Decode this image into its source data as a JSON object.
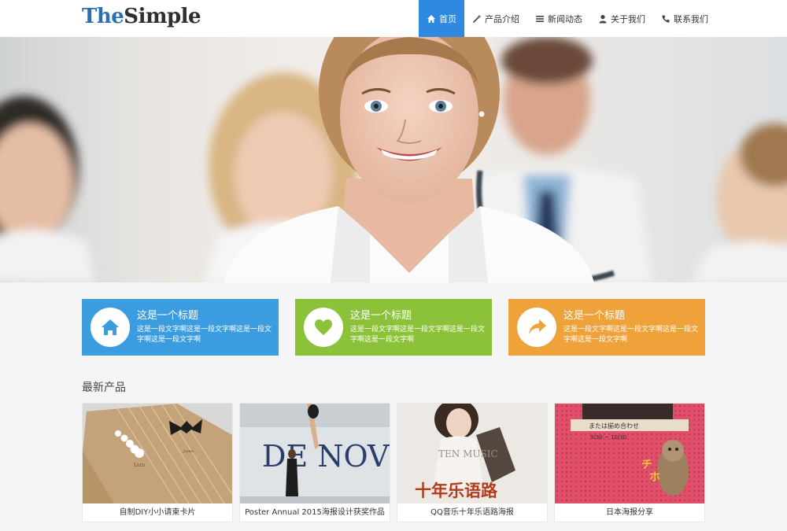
{
  "logo": {
    "part1": "The",
    "part2": "Simple"
  },
  "nav": [
    {
      "label": "首页",
      "icon": "home-icon",
      "active": true
    },
    {
      "label": "产品介绍",
      "icon": "magic-wand-icon",
      "active": false
    },
    {
      "label": "新闻动态",
      "icon": "list-icon",
      "active": false
    },
    {
      "label": "关于我们",
      "icon": "user-icon",
      "active": false
    },
    {
      "label": "联系我们",
      "icon": "phone-icon",
      "active": false
    }
  ],
  "features": [
    {
      "title": "这是一个标题",
      "desc": "这是一段文字啊这是一段文字啊这是一段文字啊这是一段文字啊",
      "icon": "home-icon",
      "color": "#3b9de0"
    },
    {
      "title": "这是一个标题",
      "desc": "这是一段文字啊这是一段文字啊这是一段文字啊这是一段文字啊",
      "icon": "heart-icon",
      "color": "#8cc23a"
    },
    {
      "title": "这是一个标题",
      "desc": "这是一段文字啊这是一段文字啊这是一段文字啊这是一段文字啊",
      "icon": "share-arrow-icon",
      "color": "#f0a23a"
    }
  ],
  "section": {
    "title": "最新产品"
  },
  "products": [
    {
      "caption": "自制DIY小小请柬卡片"
    },
    {
      "caption": "Poster Annual 2015海报设计获奖作品",
      "img_text": "DE NOVO"
    },
    {
      "caption": "QQ音乐十年乐语路海报",
      "img_text": "TEN MUSIC",
      "img_text2": "十年乐语路"
    },
    {
      "caption": "日本海报分享",
      "img_text": "または揃め合わせ"
    }
  ],
  "colors": {
    "accent": "#2e8ae0",
    "blue": "#3b9de0",
    "green": "#8cc23a",
    "orange": "#f0a23a"
  }
}
